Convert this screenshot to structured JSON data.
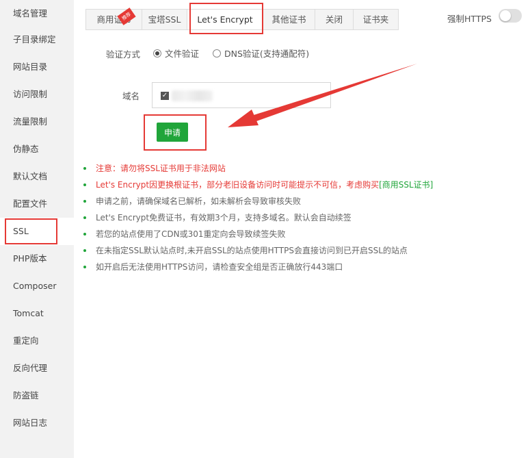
{
  "sidebar": {
    "items": [
      {
        "label": "域名管理"
      },
      {
        "label": "子目录绑定"
      },
      {
        "label": "网站目录"
      },
      {
        "label": "访问限制"
      },
      {
        "label": "流量限制"
      },
      {
        "label": "伪静态"
      },
      {
        "label": "默认文档"
      },
      {
        "label": "配置文件"
      },
      {
        "label": "SSL"
      },
      {
        "label": "PHP版本"
      },
      {
        "label": "Composer"
      },
      {
        "label": "Tomcat"
      },
      {
        "label": "重定向"
      },
      {
        "label": "反向代理"
      },
      {
        "label": "防盗链"
      },
      {
        "label": "网站日志"
      }
    ],
    "active": "SSL"
  },
  "tabs": {
    "items": [
      {
        "label": "商用证书",
        "badge": "推荐"
      },
      {
        "label": "宝塔SSL"
      },
      {
        "label": "Let's Encrypt"
      },
      {
        "label": "其他证书"
      },
      {
        "label": "关闭"
      },
      {
        "label": "证书夹"
      }
    ],
    "active": "Let's Encrypt"
  },
  "force_https": {
    "label": "强制HTTPS",
    "enabled": false
  },
  "form": {
    "verify_label": "验证方式",
    "options": [
      {
        "label": "文件验证",
        "checked": true
      },
      {
        "label": "DNS验证(支持通配符)",
        "checked": false
      }
    ],
    "domain_label": "域名",
    "domain_checked": true,
    "apply_label": "申请"
  },
  "notes": [
    {
      "text": "注意：请勿将SSL证书用于非法网站",
      "color": "red"
    },
    {
      "text": "Let's Encrypt因更换根证书，部分老旧设备访问时可能提示不可信，考虑购买",
      "link": "[商用SSL证书]",
      "color": "red"
    },
    {
      "text": "申请之前，请确保域名已解析，如未解析会导致审核失败"
    },
    {
      "text": "Let's Encrypt免费证书，有效期3个月，支持多域名。默认会自动续签"
    },
    {
      "text": "若您的站点使用了CDN或301重定向会导致续签失败"
    },
    {
      "text": "在未指定SSL默认站点时,未开启SSL的站点使用HTTPS会直接访问到已开启SSL的站点"
    },
    {
      "text": "如开启后无法使用HTTPS访问，请检查安全组是否正确放行443端口"
    }
  ],
  "colors": {
    "accent": "#20a53a",
    "warning": "#e53935",
    "annotation": "#e53935"
  },
  "icons": {
    "toggle": "toggle-switch",
    "checkbox": "checkbox-checked-icon",
    "arrow": "red-arrow-annotation"
  }
}
